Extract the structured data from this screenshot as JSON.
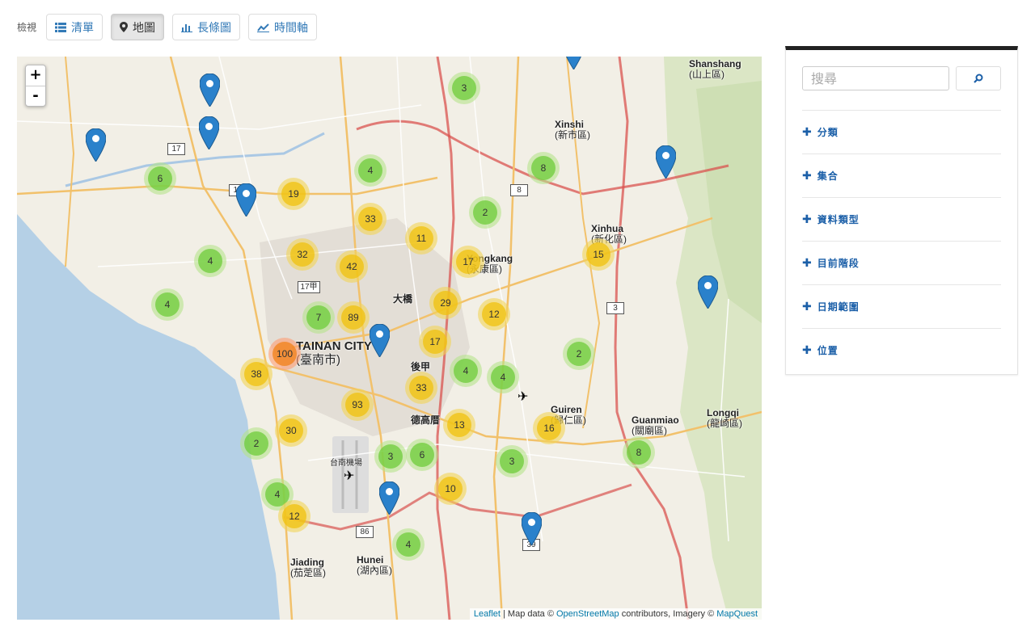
{
  "toolbar": {
    "label": "檢視",
    "views": [
      {
        "label": "清單",
        "icon": "list-icon",
        "active": false
      },
      {
        "label": "地圖",
        "icon": "map-marker-icon",
        "active": true
      },
      {
        "label": "長條圖",
        "icon": "bar-chart-icon",
        "active": false
      },
      {
        "label": "時間軸",
        "icon": "line-chart-icon",
        "active": false
      }
    ]
  },
  "map": {
    "zoom_in": "+",
    "zoom_out": "-",
    "clusters": [
      {
        "count": "3"
      },
      {
        "count": "6"
      },
      {
        "count": "4"
      },
      {
        "count": "19"
      },
      {
        "count": "8"
      },
      {
        "count": "33"
      },
      {
        "count": "2"
      },
      {
        "count": "11"
      },
      {
        "count": "4"
      },
      {
        "count": "32"
      },
      {
        "count": "42"
      },
      {
        "count": "17"
      },
      {
        "count": "15"
      },
      {
        "count": "29"
      },
      {
        "count": "12"
      },
      {
        "count": "4"
      },
      {
        "count": "7"
      },
      {
        "count": "89"
      },
      {
        "count": "17"
      },
      {
        "count": "2"
      },
      {
        "count": "100"
      },
      {
        "count": "38"
      },
      {
        "count": "4"
      },
      {
        "count": "4"
      },
      {
        "count": "33"
      },
      {
        "count": "93"
      },
      {
        "count": "13"
      },
      {
        "count": "16"
      },
      {
        "count": "30"
      },
      {
        "count": "2"
      },
      {
        "count": "3"
      },
      {
        "count": "6"
      },
      {
        "count": "3"
      },
      {
        "count": "8"
      },
      {
        "count": "10"
      },
      {
        "count": "4"
      },
      {
        "count": "12"
      },
      {
        "count": "4"
      }
    ],
    "place_labels": {
      "shanshang": "Shanshang",
      "shanshang_zh": "(山上區)",
      "xinshi": "Xinshi",
      "xinshi_zh": "(新市區)",
      "xinhua": "Xinhua",
      "xinhua_zh": "(新化區)",
      "yongkang": "Yongkang",
      "yongkang_zh": "(永康區)",
      "tainan": "TAINAN CITY",
      "tainan_zh": "(臺南市)",
      "guiren": "Guiren",
      "guiren_zh": "(歸仁區)",
      "guanmiao": "Guanmiao",
      "guanmiao_zh": "(關廟區)",
      "longqi": "Longqi",
      "longqi_zh": "(龍崎區)",
      "jiading": "Jiading",
      "jiading_zh": "(茄萣區)",
      "hunei": "Hunei",
      "hunei_zh": "(湖內區)",
      "dajiao": "大橋",
      "houjia": "後甲",
      "degao": "德高厝",
      "airport": "台南機場"
    },
    "road_shields": [
      "17",
      "8",
      "3",
      "17甲",
      "86",
      "39",
      "17"
    ],
    "attribution": {
      "leaflet": "Leaflet",
      "text1": " | Map data © ",
      "osm": "OpenStreetMap",
      "text2": " contributors, Imagery © ",
      "mapquest": "MapQuest"
    }
  },
  "sidebar": {
    "search_placeholder": "搜尋",
    "facets": [
      {
        "label": "分類"
      },
      {
        "label": "集合"
      },
      {
        "label": "資料類型"
      },
      {
        "label": "目前階段"
      },
      {
        "label": "日期範圍"
      },
      {
        "label": "位置"
      }
    ]
  },
  "colors": {
    "link": "#337ab7",
    "facet": "#1b5fa8",
    "water": "#b5d0e6",
    "marker": "#2a81cb"
  }
}
